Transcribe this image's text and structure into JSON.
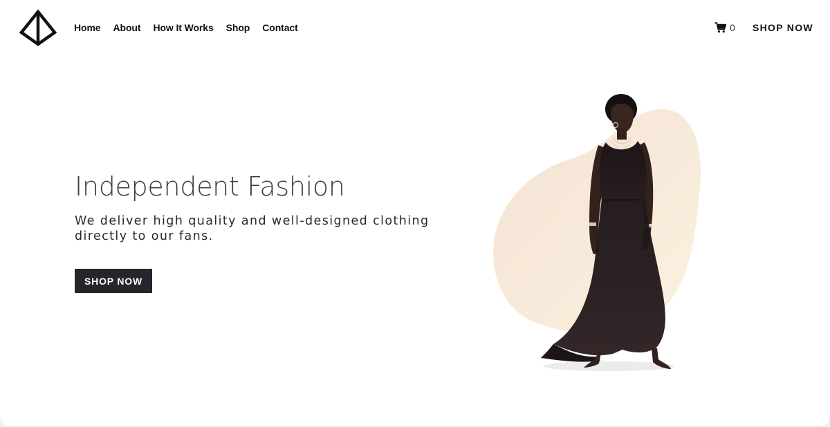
{
  "header": {
    "nav": [
      "Home",
      "About",
      "How It Works",
      "Shop",
      "Contact"
    ],
    "cart_count": "0",
    "cta_label": "SHOP NOW",
    "logo_icon": "diamond-triangle-logo-icon",
    "cart_icon": "shopping-cart-icon"
  },
  "hero": {
    "title": "Independent Fashion",
    "subtitle": "We deliver high quality and well-designed clothing directly to our fans.",
    "button_label": "SHOP NOW",
    "image_description_icon": "fashion-model-photo"
  },
  "colors": {
    "button_bg": "#25252b",
    "blob": "#f7e8d6",
    "text": "#3d3d3d"
  }
}
